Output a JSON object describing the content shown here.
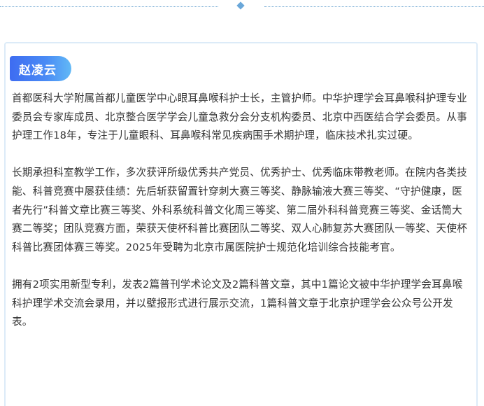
{
  "profile": {
    "name": "赵凌云",
    "paragraphs": [
      "首都医科大学附属首都儿童医学中心眼耳鼻喉科护士长，主管护师。中华护理学会耳鼻喉科护理专业委员会专家库成员、北京整合医学学会儿童急救分会分支机构委员、北京中西医结合学会委员。从事护理工作18年，专注于儿童眼科、耳鼻喉科常见疾病围手术期护理，临床技术扎实过硬。",
      "长期承担科室教学工作，多次获评所级优秀共产党员、优秀护士、优秀临床带教老师。在院内各类技能、科普竞赛中屡获佳绩：先后斩获留置针穿刺大赛三等奖、静脉输液大赛三等奖、“守护健康，医者先行”科普文章比赛三等奖、外科系统科普文化周三等奖、第二届外科科普竞赛三等奖、金话筒大赛二等奖；团队竞赛方面，荣获天使杯科普比赛团队二等奖、双人心肺复苏大赛团队一等奖、天使杯科普比赛团体赛三等奖。2025年受聘为北京市属医院护士规范化培训综合技能考官。",
      "拥有2项实用新型专利，发表2篇普刊学术论文及2篇科普文章，其中1篇论文被中华护理学会耳鼻喉科护理学术交流会录用，并以壁报形式进行展示交流，1篇科普文章于北京护理学会公众号公开发表。"
    ]
  },
  "colors": {
    "accent": "#4a8cf5",
    "text": "#333333",
    "card_border": "#dcebf8",
    "divider": "#6aa7d9"
  }
}
